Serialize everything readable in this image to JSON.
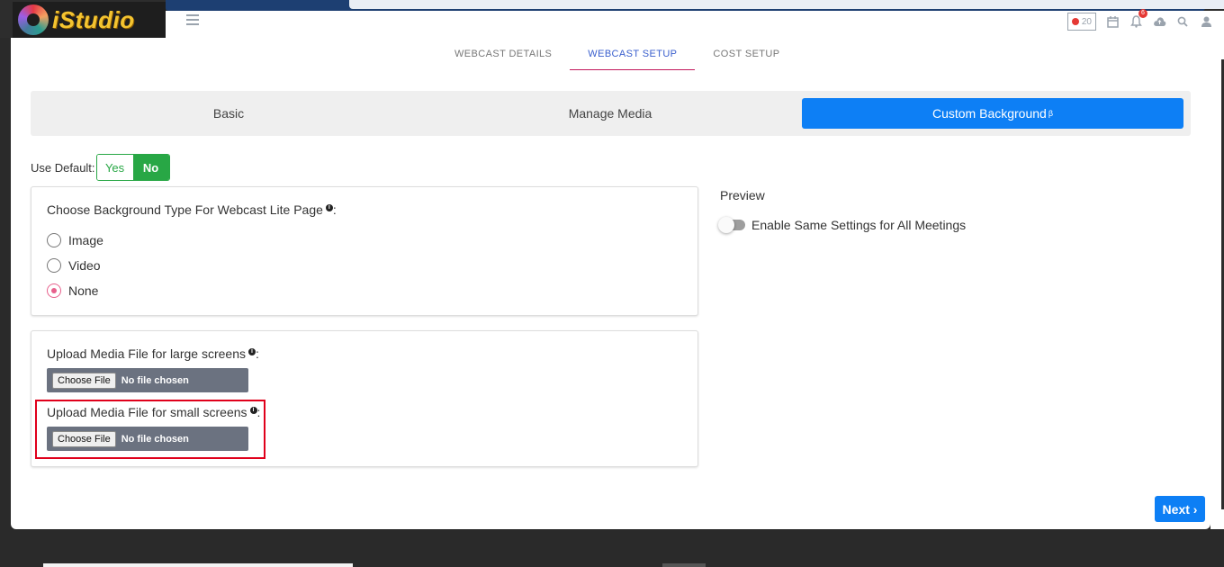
{
  "app": {
    "logo_text": "iStudio"
  },
  "topbar": {
    "rec_count": "20",
    "notification_count": "6"
  },
  "tabs": [
    {
      "label": "WEBCAST DETAILS"
    },
    {
      "label": "WEBCAST SETUP"
    },
    {
      "label": "COST SETUP"
    }
  ],
  "subtabs": [
    {
      "label": "Basic"
    },
    {
      "label": "Manage Media"
    },
    {
      "label": "Custom Background",
      "sup": "β"
    }
  ],
  "use_default": {
    "label": "Use Default:",
    "yes": "Yes",
    "no": "No"
  },
  "background_type": {
    "title": "Choose Background Type For Webcast Lite Page",
    "suffix": ":",
    "options": [
      {
        "label": "Image"
      },
      {
        "label": "Video"
      },
      {
        "label": "None"
      }
    ],
    "selected": "None"
  },
  "upload_large": {
    "title": "Upload Media File for large screens",
    "suffix": ":",
    "button": "Choose File",
    "status": "No file chosen"
  },
  "upload_small": {
    "title": "Upload Media File for small screens",
    "suffix": ":",
    "button": "Choose File",
    "status": "No file chosen"
  },
  "preview": {
    "label": "Preview",
    "switch_label": "Enable Same Settings for All Meetings"
  },
  "next_button": "Next ›",
  "colors": {
    "primary": "#0d7ff5",
    "success": "#28a745",
    "radio_checked": "#e7608c",
    "highlight": "#e0001b"
  }
}
